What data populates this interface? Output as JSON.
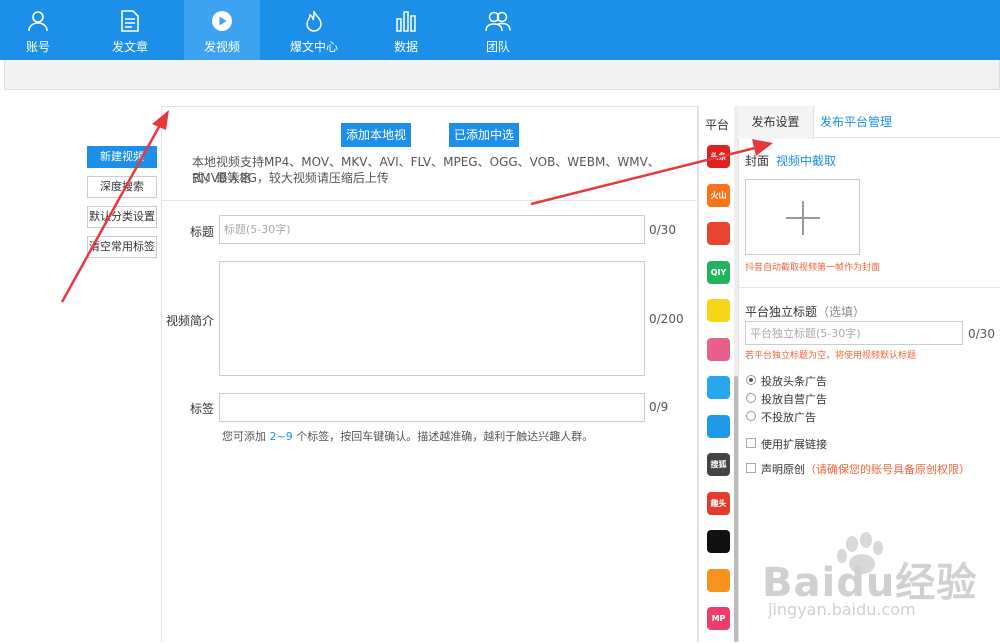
{
  "nav": [
    {
      "label": "账号",
      "icon": "user-icon"
    },
    {
      "label": "发文章",
      "icon": "article-icon"
    },
    {
      "label": "发视频",
      "icon": "play-icon"
    },
    {
      "label": "爆文中心",
      "icon": "flame-icon"
    },
    {
      "label": "数据",
      "icon": "bar-chart-icon"
    },
    {
      "label": "团队",
      "icon": "team-icon"
    }
  ],
  "left_buttons": [
    "新建视频",
    "深度搜索",
    "默认分类设置",
    "清空常用标签"
  ],
  "upload": {
    "add_local": "添加本地视频",
    "select_added": "已添加中选取",
    "hint_line1": "本地视频支持MP4、MOV、MKV、AVI、FLV、MPEG、OGG、VOB、WEBM、WMV、RMVB等格",
    "hint_line2": "式，最大2G，较大视频请压缩后上传"
  },
  "form": {
    "title_label": "标题",
    "title_placeholder": "标题(5-30字)",
    "title_count": "0/30",
    "desc_label": "视频简介",
    "desc_count": "0/200",
    "tags_label": "标签",
    "tags_count": "0/9",
    "tags_hint_pre": "您可添加",
    "tags_hint_range": "2~9",
    "tags_hint_post": "个标签，按回车键确认。描述越准确，越利于触达兴趣人群。"
  },
  "platform": {
    "title": "平台",
    "icons": [
      {
        "name": "toutiao-icon",
        "text": "头条",
        "color": "#e02020"
      },
      {
        "name": "huoshan-icon",
        "text": "火山",
        "color": "#f7741c"
      },
      {
        "name": "weibo-icon",
        "text": "",
        "color": "#e8432f"
      },
      {
        "name": "iqiyi-icon",
        "text": "QIY",
        "color": "#22b35e"
      },
      {
        "name": "yidian-icon",
        "text": "",
        "color": "#f5d619"
      },
      {
        "name": "bili-icon",
        "text": "",
        "color": "#e9618a"
      },
      {
        "name": "tencent-video-icon",
        "text": "",
        "color": "#28a8ea"
      },
      {
        "name": "youku-icon",
        "text": "",
        "color": "#1f9ae8"
      },
      {
        "name": "sohu-video-icon",
        "text": "搜狐",
        "color": "#444444"
      },
      {
        "name": "qutoutiao-icon",
        "text": "趣头条",
        "color": "#e53b2c"
      },
      {
        "name": "douyin-icon",
        "text": "",
        "color": "#111111"
      },
      {
        "name": "kuaishou-icon",
        "text": "",
        "color": "#f7921e"
      },
      {
        "name": "meipai-icon",
        "text": "MP",
        "color": "#ef3d6a"
      }
    ]
  },
  "right": {
    "tab_settings": "发布设置",
    "tab_manage": "发布平台管理",
    "cover_label": "封面",
    "cover_link": "视频中截取",
    "cover_note": "抖音自动截取视频第一帧作为封面",
    "indep_title": "平台独立标题",
    "indep_optional": "（选填）",
    "indep_placeholder": "平台独立标题(5-30字)",
    "indep_count": "0/30",
    "indep_note": "若平台独立标题为空，将使用视频默认标题",
    "ad_options": [
      "投放头条广告",
      "投放自营广告",
      "不投放广告"
    ],
    "ext_link": "使用扩展链接",
    "original": "声明原创",
    "original_note": "（请确保您的账号具备原创权限）"
  },
  "watermark": {
    "main": "Baidu经验",
    "sub": "jingyan.baidu.com"
  },
  "colors": {
    "brand": "#1c8fe8",
    "warn": "#f0643c",
    "arrow": "#e8383d"
  }
}
